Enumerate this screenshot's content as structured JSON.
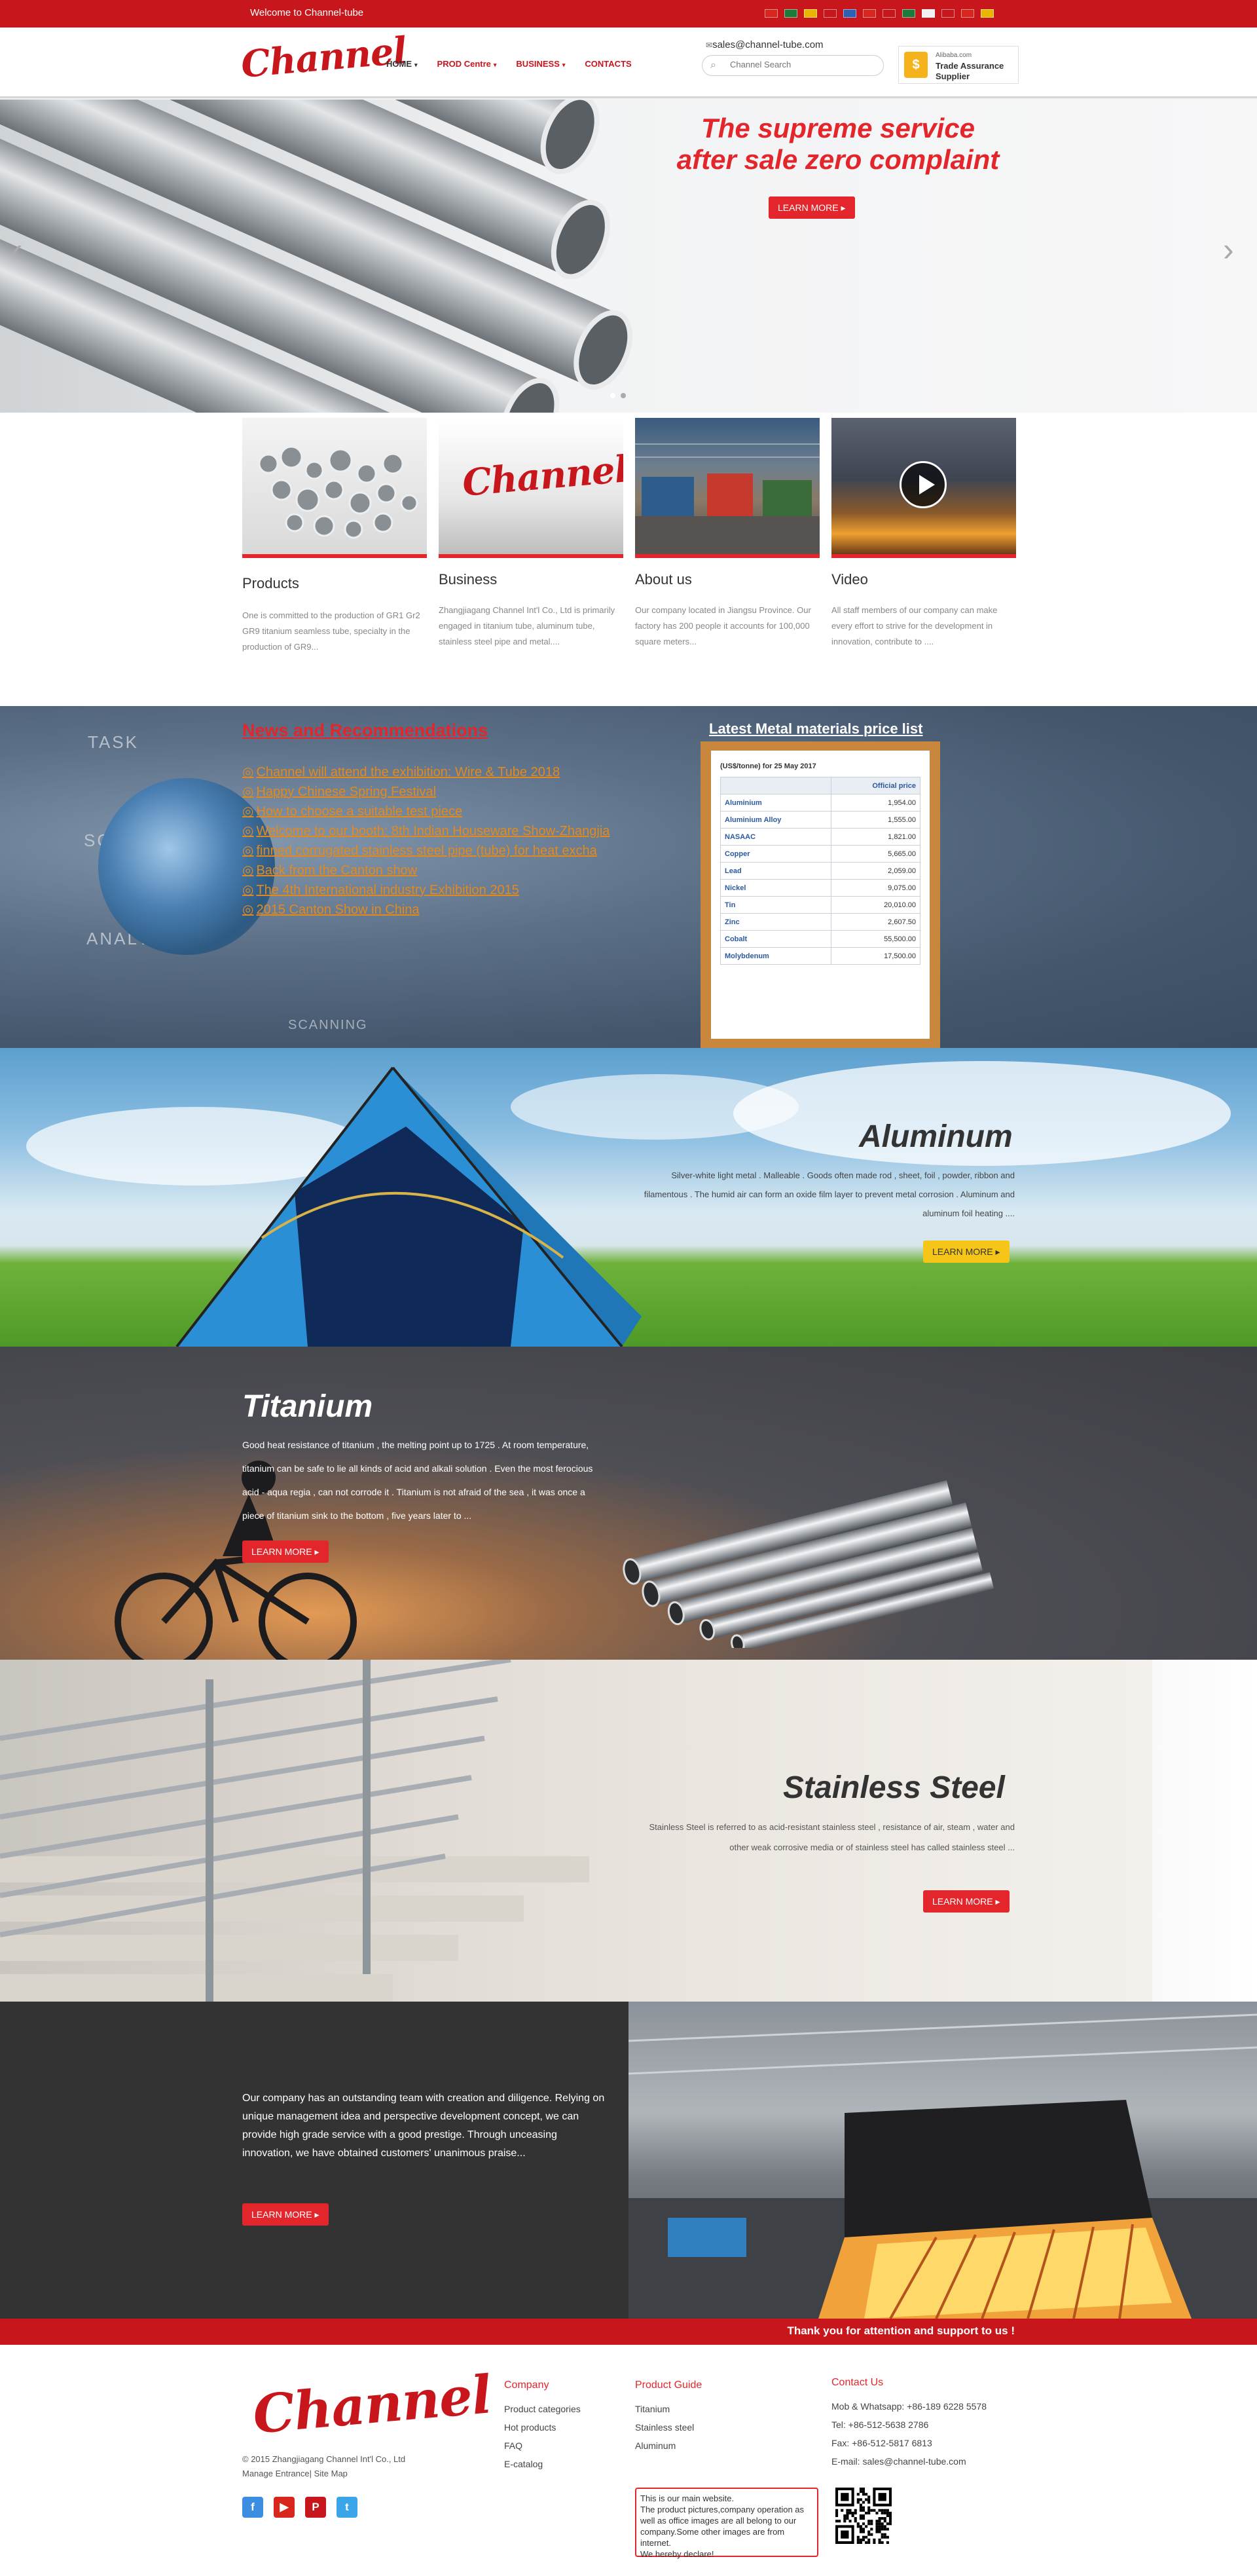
{
  "topbar": {
    "welcome": "Welcome to Channel-tube",
    "flag_colors": [
      "#d9261c",
      "#1e7a3a",
      "#e8b400",
      "#c8161d",
      "#2f5fb3",
      "#d9261c",
      "#c8161d",
      "#1e7a3a",
      "#f1f1f1",
      "#c8161d",
      "#d9261c",
      "#e8b400"
    ]
  },
  "header": {
    "logo": "Channel",
    "nav": [
      {
        "label": "HOME",
        "caret": "▾"
      },
      {
        "label": "PROD Centre",
        "caret": "▾"
      },
      {
        "label": "BUSINESS",
        "caret": "▾"
      },
      {
        "label": "CONTACTS",
        "caret": ""
      }
    ],
    "email": "sales@channel-tube.com",
    "search_placeholder": "Channel Search",
    "trade": {
      "badge": "$",
      "line1": "Alibaba.com",
      "line2": "Trade Assurance",
      "line3": "Supplier"
    }
  },
  "hero": {
    "title_line1": "The supreme service",
    "title_line2": "after sale zero complaint",
    "button": "LEARN MORE ▸",
    "prev": "‹",
    "next": "›"
  },
  "cards": [
    {
      "title": "Products",
      "text": "One is committed to the production of GR1 Gr2 GR9 titanium seamless tube, specialty in the production of GR9..."
    },
    {
      "title": "Business",
      "logo": "Channel",
      "text": "Zhangjiagang Channel Int'l Co., Ltd is primarily engaged in titanium tube, aluminum tube, stainless steel pipe and metal...."
    },
    {
      "title": "About us",
      "text": "Our company located in Jiangsu Province. Our factory has 200 people it accounts for 100,000 square meters..."
    },
    {
      "title": "Video",
      "text": "All staff members of our company can make every effort to strive for the development in innovation, contribute to ...."
    }
  ],
  "news": {
    "title": "News and Recommendations",
    "bullet": "◎",
    "items": [
      "Channel will attend the exhibition: Wire & Tube 2018",
      "Happy Chinese Spring Festival",
      "How to choose a suitable test piece",
      "Welcome to our booth: 8th Indian Houseware Show-Zhangjia",
      "finned corrugated stainless steel pipe (tube) for heat excha",
      "Back from the Canton show",
      "The 4th International industry Exhibition 2015",
      "2015 Canton Show in China"
    ],
    "bg_words": [
      "TASK",
      "SCAN",
      "ANALYSIS",
      "SCANNING"
    ]
  },
  "prices": {
    "title": "Latest Metal materials price list",
    "date": "(US$/tonne) for 25 May 2017",
    "header": "Official price",
    "rows": [
      {
        "metal": "Aluminium",
        "price": "1,954.00"
      },
      {
        "metal": "Aluminium Alloy",
        "price": "1,555.00"
      },
      {
        "metal": "NASAAC",
        "price": "1,821.00"
      },
      {
        "metal": "Copper",
        "price": "5,665.00"
      },
      {
        "metal": "Lead",
        "price": "2,059.00"
      },
      {
        "metal": "Nickel",
        "price": "9,075.00"
      },
      {
        "metal": "Tin",
        "price": "20,010.00"
      },
      {
        "metal": "Zinc",
        "price": "2,607.50"
      },
      {
        "metal": "Cobalt",
        "price": "55,500.00"
      },
      {
        "metal": "Molybdenum",
        "price": "17,500.00"
      }
    ]
  },
  "aluminum": {
    "title": "Aluminum",
    "text": "Silver-white light metal . Malleable . Goods often made rod , sheet, foil , powder, ribbon and filamentous . The humid air can form an oxide film layer to prevent metal corrosion . Aluminum and aluminum foil heating ....",
    "button": "LEARN MORE ▸"
  },
  "titanium": {
    "title": "Titanium",
    "text": "Good heat resistance of titanium , the melting point up to 1725 . At room temperature, titanium can be safe to lie all kinds of acid and alkali solution . Even the most ferocious acid - aqua regia , can not corrode it . Titanium is not afraid of the sea , it was once a piece of titanium sink to the bottom , five years later to ...",
    "button": "LEARN MORE ▸"
  },
  "stainless": {
    "title": "Stainless Steel",
    "text": "Stainless Steel is referred to as acid-resistant stainless steel , resistance of air, steam , water and other weak corrosive media or of stainless steel has called stainless steel ...",
    "button": "LEARN MORE ▸"
  },
  "company": {
    "text": "Our company has an outstanding team with creation and diligence. Relying on unique management idea and perspective development concept, we can provide high grade service with a good prestige. Through unceasing innovation, we have obtained customers' unanimous praise...",
    "button": "LEARN MORE ▸"
  },
  "thanks": "Thank you for attention and support to us !",
  "footer": {
    "logo": "Channel",
    "copyright": "© 2015 Zhangjiagang Channel Int'l Co., Ltd",
    "links": "Manage Entrance| Site Map",
    "social": [
      {
        "icon": "facebook-icon",
        "glyph": "f",
        "color": "#3b8ee0"
      },
      {
        "icon": "youtube-icon",
        "glyph": "▶",
        "color": "#d9261c"
      },
      {
        "icon": "pinterest-icon",
        "glyph": "P",
        "color": "#c8161d"
      },
      {
        "icon": "twitter-icon",
        "glyph": "t",
        "color": "#3aa5e8"
      }
    ],
    "company": {
      "title": "Company",
      "items": [
        "Product categories",
        "Hot products",
        "FAQ",
        "E-catalog"
      ]
    },
    "guide": {
      "title": "Product Guide",
      "items": [
        "Titanium",
        "Stainless steel",
        "Aluminum"
      ]
    },
    "contact": {
      "title": "Contact Us",
      "items": [
        "Mob & Whatsapp: +86-189 6228 5578",
        "Tel: +86-512-5638 2786",
        "Fax: +86-512-5817 6813",
        "E-mail: sales@channel-tube.com"
      ]
    },
    "note": "This is our main website.\nThe product pictures,company operation as well as office images are all belong to our company.Some other images are from internet.\nWe hereby declare!"
  }
}
